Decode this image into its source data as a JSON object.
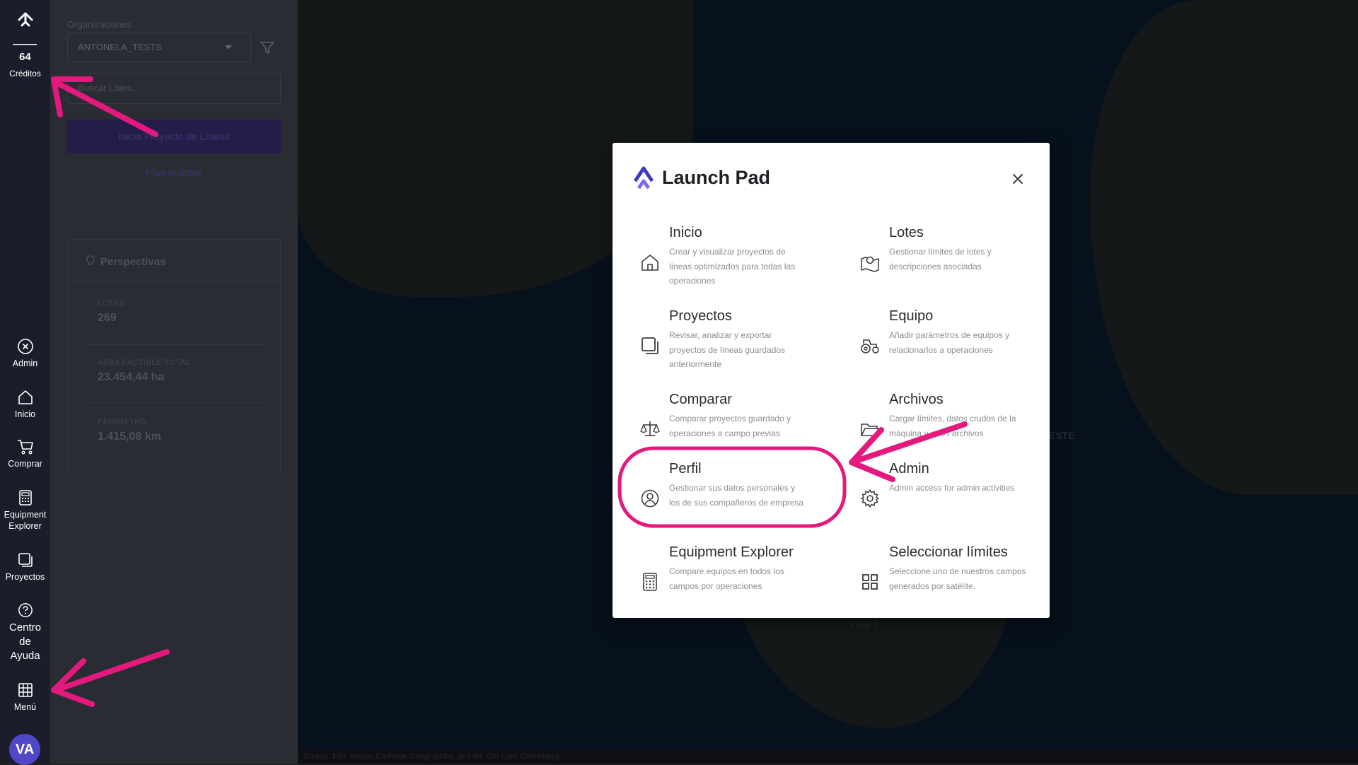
{
  "rail": {
    "credits_value": "64",
    "credits_label": "Créditos",
    "nav": [
      {
        "label": "Admin",
        "icon": "circle-x-icon"
      },
      {
        "label": "Inicio",
        "icon": "home-icon"
      },
      {
        "label": "Comprar",
        "icon": "cart-icon"
      },
      {
        "label": "Equipment Explorer",
        "icon": "calculator-icon"
      },
      {
        "label": "Proyectos",
        "icon": "projects-icon"
      },
      {
        "label": "Centro de Ayuda",
        "icon": "help-icon"
      },
      {
        "label": "Menú",
        "icon": "grid-icon"
      }
    ],
    "avatar": "VA"
  },
  "panel": {
    "org_label": "Organizaciones",
    "org_value": "ANTONELA_TESTS",
    "search_placeholder": "Buscar Lotes...",
    "start_button": "Inicia Proyecto de Líneas",
    "multi_plan": "Plan múltiple",
    "perspectives_title": "Perspectivas",
    "stats": [
      {
        "label": "LOTES",
        "value": "269"
      },
      {
        "label": "ÁREA FACTIBLE TOTAL",
        "value": "23.454,44 ha"
      },
      {
        "label": "PERÍMETRO",
        "value": "1.415,08 km"
      }
    ]
  },
  "map": {
    "labels": [
      "ESTE",
      "Lote 1"
    ],
    "attribution": "Source: Esri, Maxar, Earthstar Geographics, and the GIS User Community"
  },
  "modal": {
    "title": "Launch Pad",
    "items": [
      {
        "name": "Inicio",
        "desc": "Crear y visualizar proyectos de líneas optimizados para todas las operaciones",
        "icon": "home-icon"
      },
      {
        "name": "Lotes",
        "desc": "Gestionar límites de lotes y descripciones asociadas",
        "icon": "map-pin-icon"
      },
      {
        "name": "Proyectos",
        "desc": "Revisar, analizar y exportar proyectos de líneas guardados anteriormente",
        "icon": "projects-icon"
      },
      {
        "name": "Equipo",
        "desc": "Añadir parámetros de equipos y relacionarlos a operaciones",
        "icon": "tractor-icon"
      },
      {
        "name": "Comparar",
        "desc": "Comparar proyectos guardado y operaciones a campo previas",
        "icon": "scale-icon"
      },
      {
        "name": "Archivos",
        "desc": "Cargar límites, datos crudos de la máquina y otros archivos",
        "icon": "folder-icon"
      },
      {
        "name": "Perfil",
        "desc": "Gestionar sus datos personales y los de sus compañeros de empresa",
        "icon": "user-circle-icon"
      },
      {
        "name": "Admin",
        "desc": "Admin access for admin activities",
        "icon": "gear-icon"
      },
      {
        "name": "Equipment Explorer",
        "desc": "Compare equipos en todos los campos por operaciones",
        "icon": "calculator-icon"
      },
      {
        "name": "Seleccionar límites",
        "desc": "Seleccione uno de nuestros campos generados por satélite.",
        "icon": "grid-icon"
      }
    ]
  },
  "colors": {
    "rail_bg": "#1b1d2a",
    "accent": "#4f46c8",
    "annotation": "#e5197d"
  }
}
